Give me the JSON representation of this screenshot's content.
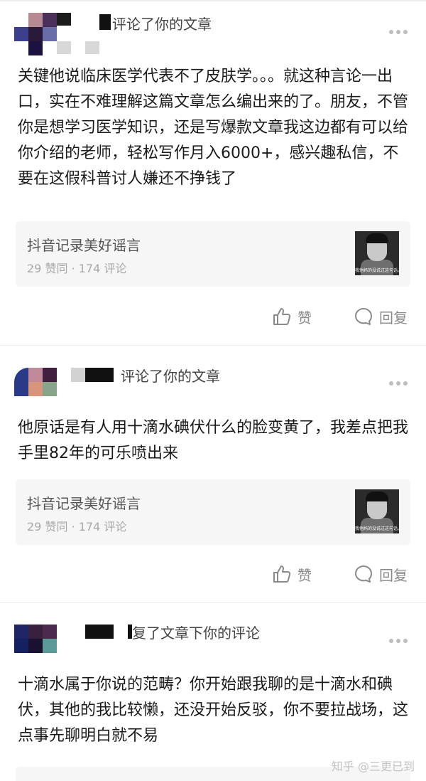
{
  "comments": [
    {
      "action": "评论了你的文章",
      "content": "关键他说临床医学代表不了皮肤学。。。就这种言论一出口，实在不难理解这篇文章怎么编出来的了。朋友，不管你是想学习医学知识，还是写爆款文章我这边都有可以给你介绍的老师，轻松写作月入6000+，感兴趣私信，不要在这假科普讨人嫌还不挣钱了",
      "article": {
        "title": "抖音记录美好谣言",
        "meta": "29 赞同 · 174 评论",
        "thumb_caption": "我他妈的没说过这句话。"
      },
      "like_label": "赞",
      "reply_label": "回复"
    },
    {
      "action": "评论了你的文章",
      "content": "他原话是有人用十滴水碘伏什么的脸变黄了，我差点把我手里82年的可乐喷出来",
      "article": {
        "title": "抖音记录美好谣言",
        "meta": "29 赞同 · 174 评论",
        "thumb_caption": "我他妈的没说过这句话。"
      },
      "like_label": "赞",
      "reply_label": "回复"
    },
    {
      "action": "复了文章下你的评论",
      "content": "十滴水属于你说的范畴？你开始跟我聊的是十滴水和碘伏，其他的我比较懒，还没开始反驳，你不要拉战场，这点事先聊明白就不易"
    }
  ],
  "watermark": "知乎 @三更已到",
  "icons": {
    "like": "thumbs-up-icon",
    "reply": "speech-bubble-icon",
    "more": "more-dots-icon"
  },
  "colors": {
    "text": "#1a1a1a",
    "muted": "#8a8a8a",
    "card_bg": "#f6f6f6"
  }
}
